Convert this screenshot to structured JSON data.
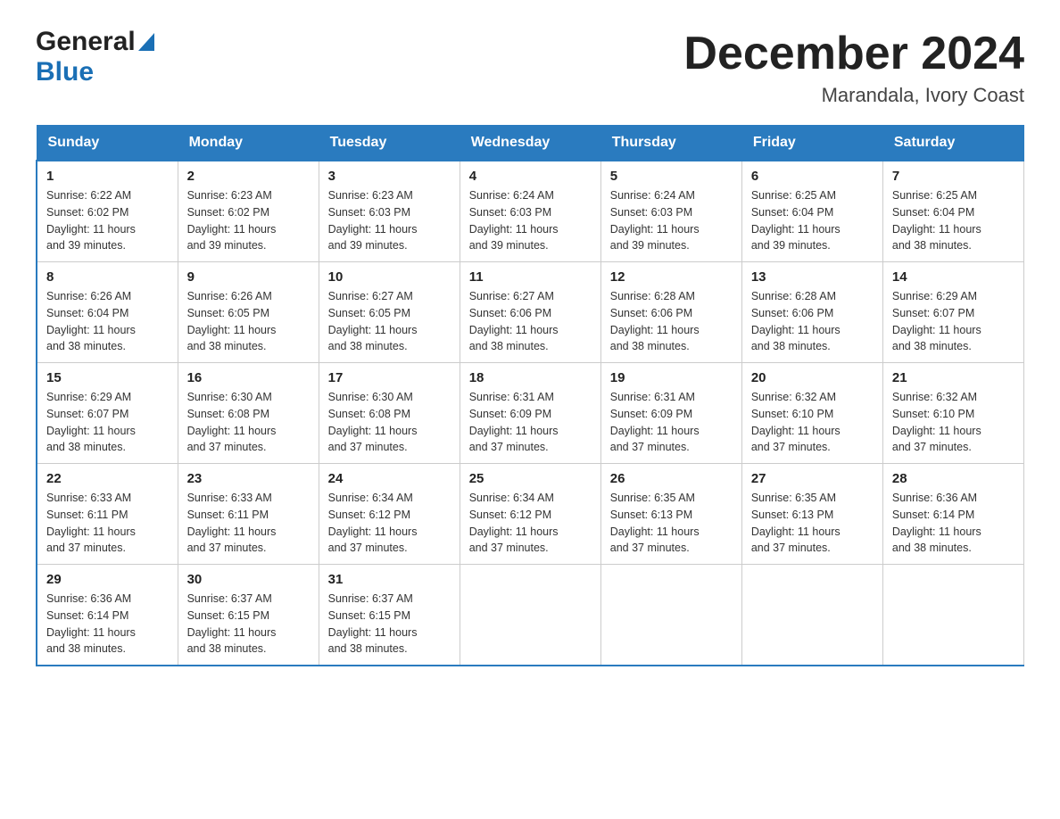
{
  "header": {
    "logo_general": "General",
    "logo_blue": "Blue",
    "month_title": "December 2024",
    "location": "Marandala, Ivory Coast"
  },
  "days_of_week": [
    "Sunday",
    "Monday",
    "Tuesday",
    "Wednesday",
    "Thursday",
    "Friday",
    "Saturday"
  ],
  "weeks": [
    [
      {
        "day": "1",
        "sunrise": "6:22 AM",
        "sunset": "6:02 PM",
        "daylight": "11 hours and 39 minutes."
      },
      {
        "day": "2",
        "sunrise": "6:23 AM",
        "sunset": "6:02 PM",
        "daylight": "11 hours and 39 minutes."
      },
      {
        "day": "3",
        "sunrise": "6:23 AM",
        "sunset": "6:03 PM",
        "daylight": "11 hours and 39 minutes."
      },
      {
        "day": "4",
        "sunrise": "6:24 AM",
        "sunset": "6:03 PM",
        "daylight": "11 hours and 39 minutes."
      },
      {
        "day": "5",
        "sunrise": "6:24 AM",
        "sunset": "6:03 PM",
        "daylight": "11 hours and 39 minutes."
      },
      {
        "day": "6",
        "sunrise": "6:25 AM",
        "sunset": "6:04 PM",
        "daylight": "11 hours and 39 minutes."
      },
      {
        "day": "7",
        "sunrise": "6:25 AM",
        "sunset": "6:04 PM",
        "daylight": "11 hours and 38 minutes."
      }
    ],
    [
      {
        "day": "8",
        "sunrise": "6:26 AM",
        "sunset": "6:04 PM",
        "daylight": "11 hours and 38 minutes."
      },
      {
        "day": "9",
        "sunrise": "6:26 AM",
        "sunset": "6:05 PM",
        "daylight": "11 hours and 38 minutes."
      },
      {
        "day": "10",
        "sunrise": "6:27 AM",
        "sunset": "6:05 PM",
        "daylight": "11 hours and 38 minutes."
      },
      {
        "day": "11",
        "sunrise": "6:27 AM",
        "sunset": "6:06 PM",
        "daylight": "11 hours and 38 minutes."
      },
      {
        "day": "12",
        "sunrise": "6:28 AM",
        "sunset": "6:06 PM",
        "daylight": "11 hours and 38 minutes."
      },
      {
        "day": "13",
        "sunrise": "6:28 AM",
        "sunset": "6:06 PM",
        "daylight": "11 hours and 38 minutes."
      },
      {
        "day": "14",
        "sunrise": "6:29 AM",
        "sunset": "6:07 PM",
        "daylight": "11 hours and 38 minutes."
      }
    ],
    [
      {
        "day": "15",
        "sunrise": "6:29 AM",
        "sunset": "6:07 PM",
        "daylight": "11 hours and 38 minutes."
      },
      {
        "day": "16",
        "sunrise": "6:30 AM",
        "sunset": "6:08 PM",
        "daylight": "11 hours and 37 minutes."
      },
      {
        "day": "17",
        "sunrise": "6:30 AM",
        "sunset": "6:08 PM",
        "daylight": "11 hours and 37 minutes."
      },
      {
        "day": "18",
        "sunrise": "6:31 AM",
        "sunset": "6:09 PM",
        "daylight": "11 hours and 37 minutes."
      },
      {
        "day": "19",
        "sunrise": "6:31 AM",
        "sunset": "6:09 PM",
        "daylight": "11 hours and 37 minutes."
      },
      {
        "day": "20",
        "sunrise": "6:32 AM",
        "sunset": "6:10 PM",
        "daylight": "11 hours and 37 minutes."
      },
      {
        "day": "21",
        "sunrise": "6:32 AM",
        "sunset": "6:10 PM",
        "daylight": "11 hours and 37 minutes."
      }
    ],
    [
      {
        "day": "22",
        "sunrise": "6:33 AM",
        "sunset": "6:11 PM",
        "daylight": "11 hours and 37 minutes."
      },
      {
        "day": "23",
        "sunrise": "6:33 AM",
        "sunset": "6:11 PM",
        "daylight": "11 hours and 37 minutes."
      },
      {
        "day": "24",
        "sunrise": "6:34 AM",
        "sunset": "6:12 PM",
        "daylight": "11 hours and 37 minutes."
      },
      {
        "day": "25",
        "sunrise": "6:34 AM",
        "sunset": "6:12 PM",
        "daylight": "11 hours and 37 minutes."
      },
      {
        "day": "26",
        "sunrise": "6:35 AM",
        "sunset": "6:13 PM",
        "daylight": "11 hours and 37 minutes."
      },
      {
        "day": "27",
        "sunrise": "6:35 AM",
        "sunset": "6:13 PM",
        "daylight": "11 hours and 37 minutes."
      },
      {
        "day": "28",
        "sunrise": "6:36 AM",
        "sunset": "6:14 PM",
        "daylight": "11 hours and 38 minutes."
      }
    ],
    [
      {
        "day": "29",
        "sunrise": "6:36 AM",
        "sunset": "6:14 PM",
        "daylight": "11 hours and 38 minutes."
      },
      {
        "day": "30",
        "sunrise": "6:37 AM",
        "sunset": "6:15 PM",
        "daylight": "11 hours and 38 minutes."
      },
      {
        "day": "31",
        "sunrise": "6:37 AM",
        "sunset": "6:15 PM",
        "daylight": "11 hours and 38 minutes."
      },
      null,
      null,
      null,
      null
    ]
  ],
  "labels": {
    "sunrise": "Sunrise:",
    "sunset": "Sunset:",
    "daylight": "Daylight:"
  }
}
